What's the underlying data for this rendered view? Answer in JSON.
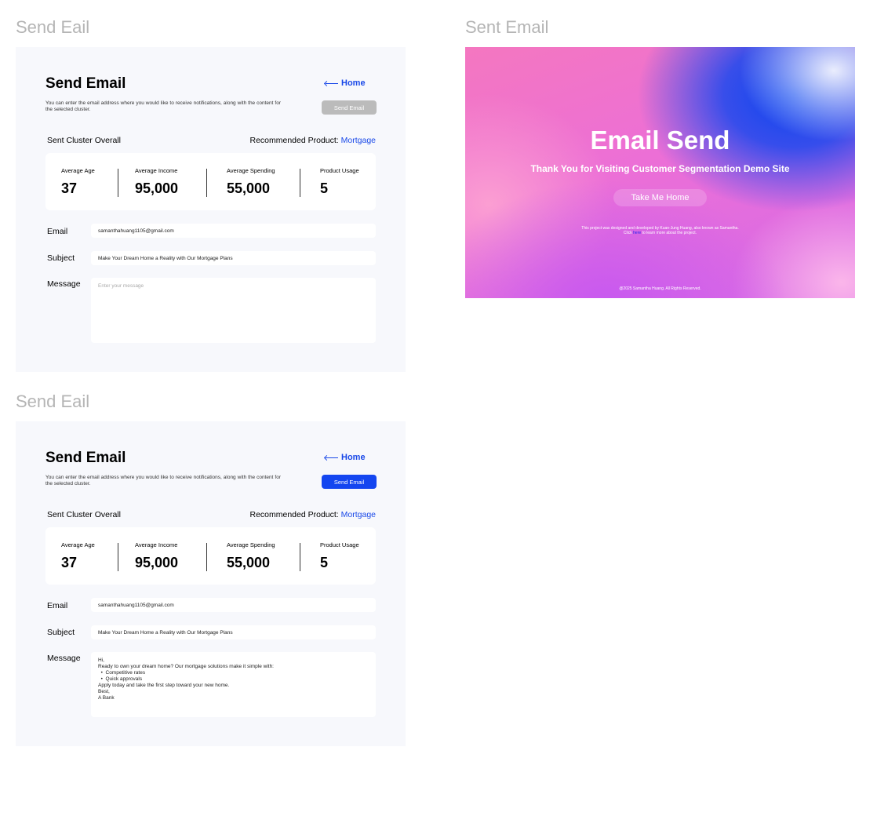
{
  "frames": {
    "top_left_label": "Send Eail",
    "bottom_left_label": "Send Eail",
    "right_label": "Sent Email"
  },
  "form_template": {
    "title": "Send Email",
    "home_link": "Home",
    "description": "You can enter the email address where you would like to receive notifications, along with the content for the selected cluster.",
    "send_button": "Send Email",
    "overall_label": "Sent Cluster Overall",
    "recommended_label": "Recommended Product:",
    "recommended_product": "Mortgage",
    "stats": [
      {
        "label": "Average Age",
        "value": "37"
      },
      {
        "label": "Average Income",
        "value": "95,000"
      },
      {
        "label": "Average Spending",
        "value": "55,000"
      },
      {
        "label": "Product Usage",
        "value": "5"
      }
    ],
    "email_label": "Email",
    "email_value": "samanthahuang1105@gmail.com",
    "subject_label": "Subject",
    "subject_value": "Make Your Dream Home a Reality with Our Mortgage Plans",
    "message_label": "Message"
  },
  "form_empty": {
    "send_state": "disabled",
    "message_placeholder": "Enter your message"
  },
  "form_filled": {
    "send_state": "active",
    "message_lines": [
      "Hi,",
      "",
      "Ready to own your dream home? Our mortgage solutions make it simple with:",
      "  •  Competitive rates",
      "  •  Quick approvals",
      "Apply today and take the first step toward your new home.",
      "",
      "Best,",
      "A Bank"
    ]
  },
  "sent_page": {
    "title": "Email Send",
    "subtitle": "Thank You for Visiting Customer Segmentation Demo Site",
    "button": "Take Me Home",
    "credit_line1": "This project was designed and developed by Kuan-Jung Huang, also known as Samantha.",
    "credit_click": "Click",
    "credit_link": "here",
    "credit_after": "to learn more about the project.",
    "copyright": "@2025 Samantha Huang. All Rights Reserved."
  },
  "colors": {
    "accent": "#1446f0",
    "disabled": "#bbbbbb",
    "panel_bg": "#f7f8fc"
  }
}
